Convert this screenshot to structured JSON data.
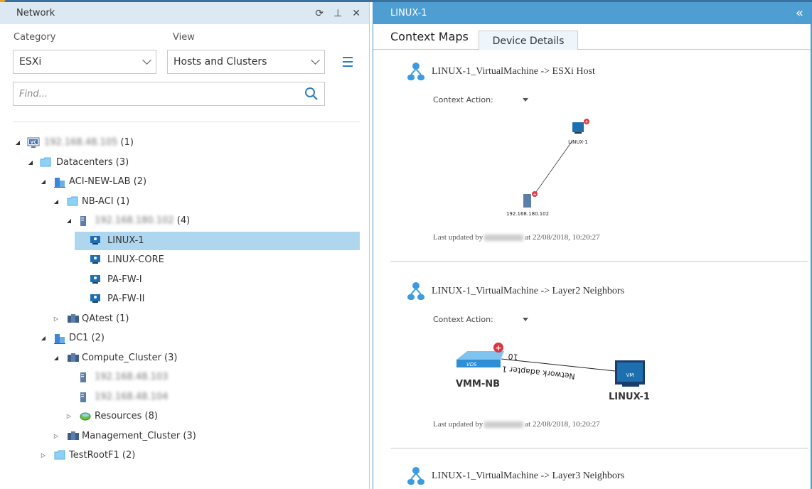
{
  "left_panel": {
    "title": "Network",
    "category_label": "Category",
    "category_value": "ESXi",
    "view_label": "View",
    "view_value": "Hosts and Clusters",
    "find_placeholder": "Find..."
  },
  "tree": [
    {
      "level": 0,
      "icon": "vcenter-icon",
      "label": "192.168.48.105",
      "blurred": true,
      "count": "(1)",
      "toggle": "expanded"
    },
    {
      "level": 1,
      "icon": "folder-icon",
      "label": "Datacenters (3)",
      "toggle": "expanded"
    },
    {
      "level": 2,
      "icon": "datacenter-icon",
      "label": "ACI-NEW-LAB (2)",
      "toggle": "expanded"
    },
    {
      "level": 3,
      "icon": "folder-icon",
      "label": "NB-ACI (1)",
      "toggle": "expanded"
    },
    {
      "level": 4,
      "icon": "host-icon",
      "label": "192.168.180.102",
      "blurred": true,
      "count": "(4)",
      "toggle": "expanded"
    },
    {
      "level": 5,
      "icon": "vm-icon",
      "label": "LINUX-1",
      "selected": true
    },
    {
      "level": 5,
      "icon": "vm-icon",
      "label": "LINUX-CORE"
    },
    {
      "level": 5,
      "icon": "vm-icon",
      "label": "PA-FW-I"
    },
    {
      "level": 5,
      "icon": "vm-icon",
      "label": "PA-FW-II"
    },
    {
      "level": 3,
      "icon": "cluster-icon",
      "label": "QAtest (1)",
      "toggle": "collapsed"
    },
    {
      "level": 2,
      "icon": "datacenter-icon",
      "label": "DC1 (2)",
      "toggle": "expanded"
    },
    {
      "level": 3,
      "icon": "cluster-icon",
      "label": "Compute_Cluster (3)",
      "toggle": "expanded"
    },
    {
      "level": 4,
      "icon": "host-icon",
      "label": "192.168.48.103",
      "blurred": true
    },
    {
      "level": 4,
      "icon": "host-icon",
      "label": "192.168.48.104",
      "blurred": true
    },
    {
      "level": 4,
      "icon": "resource-pool-icon",
      "label": "Resources (8)",
      "toggle": "collapsed"
    },
    {
      "level": 3,
      "icon": "cluster-icon",
      "label": "Management_Cluster (3)",
      "toggle": "collapsed"
    },
    {
      "level": 2,
      "icon": "folder-icon",
      "label": "TestRootF1 (2)",
      "toggle": "collapsed"
    }
  ],
  "right_panel": {
    "title": "LINUX-1",
    "tabs": [
      {
        "label": "Context Maps",
        "active": true
      },
      {
        "label": "Device Details",
        "active": false
      }
    ]
  },
  "sections": [
    {
      "title": "LINUX-1_VirtualMachine -> ESXi Host",
      "context_action": "Context Action:",
      "nodes": [
        "LINUX-1",
        "192.168.180.102"
      ],
      "updated_prefix": "Last updated by",
      "updated_suffix": "at 22/08/2018, 10:20:27"
    },
    {
      "title": "LINUX-1_VirtualMachine -> Layer2 Neighbors",
      "context_action": "Context Action:",
      "nodes": [
        "VMM-NB",
        "LINUX-1"
      ],
      "link_labels": [
        "10",
        "Network adapter 1"
      ],
      "vds_label": "VDS",
      "vm_label": "VM",
      "updated_prefix": "Last updated by",
      "updated_suffix": "at 22/08/2018, 10:20:27"
    },
    {
      "title": "LINUX-1_VirtualMachine -> Layer3 Neighbors"
    }
  ],
  "colors": {
    "header_blue": "#4f9ed2",
    "selection": "#aed6ee",
    "alert_red": "#d9363e"
  }
}
